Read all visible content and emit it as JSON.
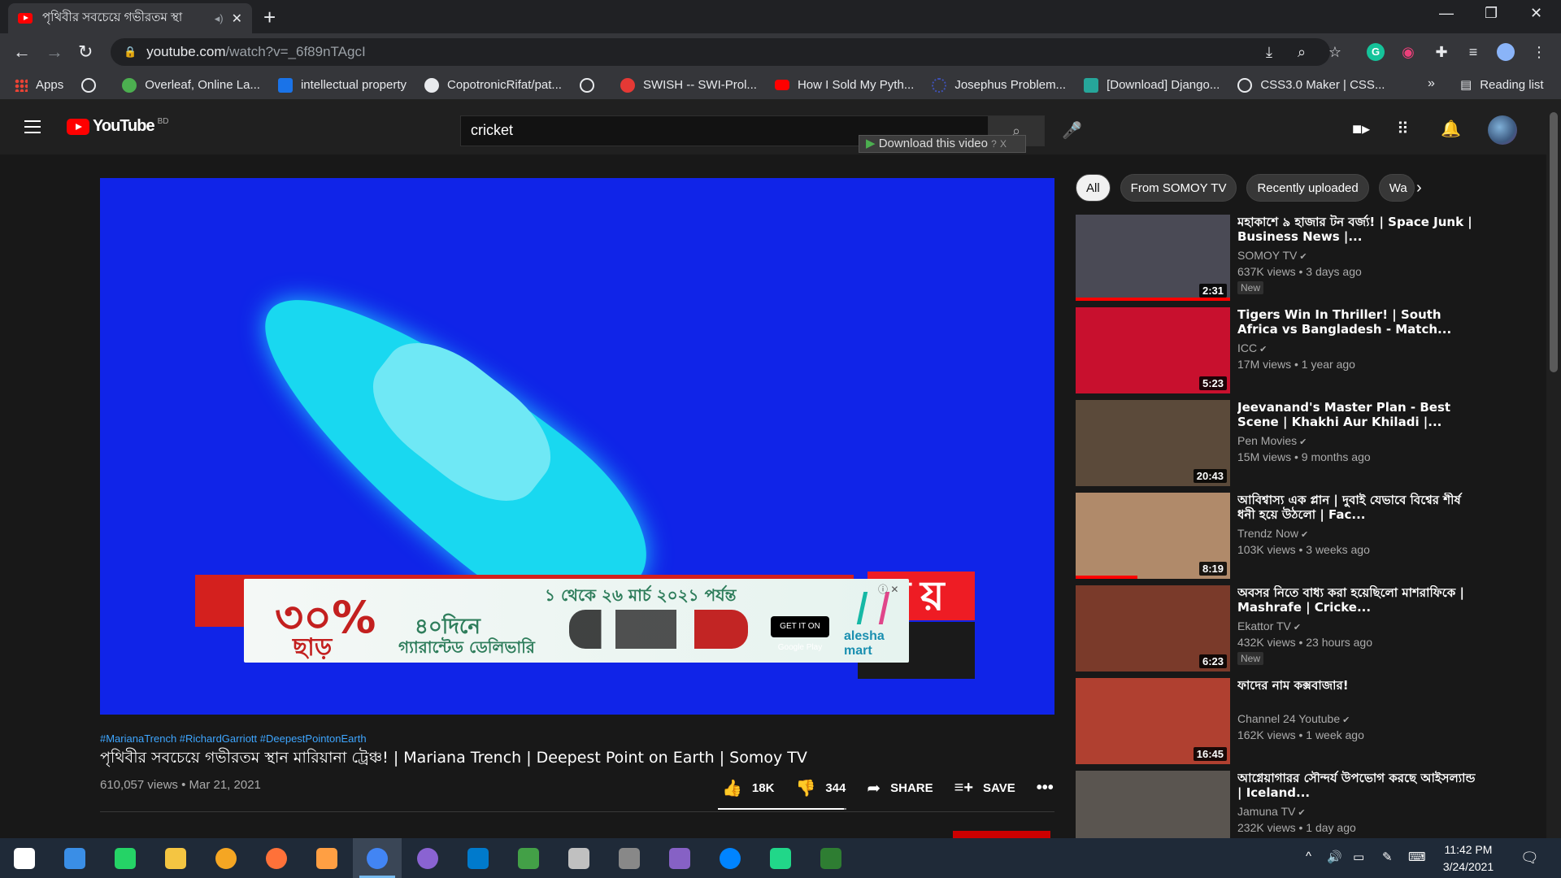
{
  "browser": {
    "tab_title": "পৃথিবীর সবচেয়ে গভীরতম স্থা",
    "url_host": "youtube.com",
    "url_path": "/watch?v=_6f89nTAgcI",
    "reading_list": "Reading list",
    "bookmarks": [
      {
        "label": "Apps",
        "color": "#ea4335"
      },
      {
        "label": "",
        "color": "#e8eaed"
      },
      {
        "label": "Overleaf, Online La...",
        "color": "#4caf50"
      },
      {
        "label": "intellectual property",
        "color": "#1a73e8"
      },
      {
        "label": "CopotronicRifat/pat...",
        "color": "#e8eaed"
      },
      {
        "label": "",
        "color": "#e8eaed"
      },
      {
        "label": "SWISH -- SWI-Prol...",
        "color": "#e53935"
      },
      {
        "label": "How I Sold My Pyth...",
        "color": "#ff0000"
      },
      {
        "label": "Josephus Problem...",
        "color": "#3f51b5"
      },
      {
        "label": "[Download] Django...",
        "color": "#26a69a"
      },
      {
        "label": "CSS3.0 Maker | CSS...",
        "color": "#e8eaed"
      }
    ]
  },
  "youtube": {
    "logo_text": "YouTube",
    "country_code": "BD",
    "search_value": "cricket",
    "download_label": "Download this video",
    "download_help": "?",
    "download_close": "X"
  },
  "video": {
    "ad": {
      "percent": "৩০%",
      "off": "ছাড়",
      "date_range": "১ থেকে ২৬ মার্চ ২০২১ পর্যন্ত",
      "days": "৪০দিনে",
      "delivery": "গ্যারান্টেড ডেলিভারি",
      "store": "GET IT ON Google Play",
      "brand": "alesha mart"
    },
    "channel_logo": "ময়",
    "hashtags": "#MarianaTrench #RichardGarriott #DeepestPointonEarth",
    "title": "পৃথিবীর সবচেয়ে গভীরতম স্থান মারিয়ানা ট্রেঞ্চ! | Mariana Trench | Deepest Point on Earth | Somoy TV",
    "views": "610,057 views",
    "date": "Mar 21, 2021",
    "likes": "18K",
    "dislikes": "344",
    "share_label": "SHARE",
    "save_label": "SAVE",
    "like_ratio": 0.98
  },
  "chips": [
    "All",
    "From SOMOY TV",
    "Recently uploaded",
    "Wa"
  ],
  "recommendations": [
    {
      "title": "মহাকাশে ৯ হাজার টন বর্জ্য! | Space Junk | Business News |...",
      "channel": "SOMOY TV",
      "meta": "637K views • 3 days ago",
      "duration": "2:31",
      "badge": "New",
      "thumb": "#4a4a55",
      "progress": 1.0
    },
    {
      "title": "Tigers Win In Thriller! | South Africa vs Bangladesh - Match...",
      "channel": "ICC",
      "meta": "17M views • 1 year ago",
      "duration": "5:23",
      "badge": "",
      "thumb": "#c8102e",
      "progress": 0
    },
    {
      "title": "Jeevanand's Master Plan - Best Scene | Khakhi Aur Khiladi |...",
      "channel": "Pen Movies",
      "meta": "15M views • 9 months ago",
      "duration": "20:43",
      "badge": "",
      "thumb": "#5b4a3a",
      "progress": 0
    },
    {
      "title": "আবিশ্বাস্য এক প্লান | দুবাই যেভাবে বিশ্বের শীর্ষ ধনী হয়ে উঠলো | Fac...",
      "channel": "Trendz Now",
      "meta": "103K views • 3 weeks ago",
      "duration": "8:19",
      "badge": "",
      "thumb": "#b08a6a",
      "progress": 0.4
    },
    {
      "title": "অবসর নিতে বাধ্য করা হয়েছিলো মাশরাফিকে | Mashrafe | Cricke...",
      "channel": "Ekattor TV",
      "meta": "432K views • 23 hours ago",
      "duration": "6:23",
      "badge": "New",
      "thumb": "#7a3a2a",
      "progress": 0
    },
    {
      "title": "ফাদের নাম কক্সবাজার!",
      "channel": "Channel 24 Youtube",
      "meta": "162K views • 1 week ago",
      "duration": "16:45",
      "badge": "",
      "thumb": "#b04030",
      "progress": 0
    },
    {
      "title": "আগ্নেয়াগারর সৌন্দর্য উপভোগ করছে আইসল্যান্ড | Iceland...",
      "channel": "Jamuna TV",
      "meta": "232K views • 1 day ago",
      "duration": "",
      "badge": "",
      "thumb": "#5a5550",
      "progress": 0
    }
  ],
  "taskbar": {
    "time": "11:42 PM",
    "date": "3/24/2021",
    "apps": [
      {
        "name": "start",
        "color": "#ffffff"
      },
      {
        "name": "search",
        "color": "#3a8ee6"
      },
      {
        "name": "whatsapp",
        "color": "#25d366"
      },
      {
        "name": "file-explorer",
        "color": "#f4c542"
      },
      {
        "name": "app-yellow",
        "color": "#f5a623"
      },
      {
        "name": "firefox",
        "color": "#ff7139"
      },
      {
        "name": "app-orange",
        "color": "#ff9f43"
      },
      {
        "name": "chrome",
        "color": "#4285f4"
      },
      {
        "name": "github",
        "color": "#8a63d2"
      },
      {
        "name": "vscode",
        "color": "#007acc"
      },
      {
        "name": "app-globe",
        "color": "#43a047"
      },
      {
        "name": "app-palette",
        "color": "#c0c0c0"
      },
      {
        "name": "app-satellite",
        "color": "#888888"
      },
      {
        "name": "visual-studio",
        "color": "#8661c5"
      },
      {
        "name": "messenger",
        "color": "#0084ff"
      },
      {
        "name": "pycharm",
        "color": "#21d789"
      },
      {
        "name": "app-green",
        "color": "#2e7d32"
      }
    ]
  }
}
